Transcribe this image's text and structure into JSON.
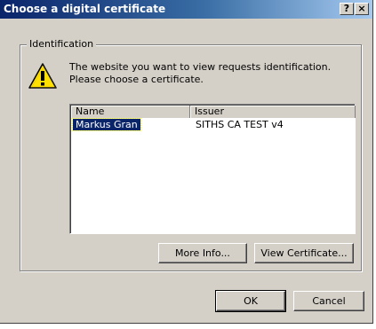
{
  "dialog": {
    "title": "Choose a digital certificate",
    "help_glyph": "?",
    "close_glyph": "×"
  },
  "identification": {
    "legend": "Identification",
    "icon": "warning-icon",
    "message_line1": "The website you want to view requests identification.",
    "message_line2": "Please choose a certificate."
  },
  "certificate_list": {
    "columns": [
      "Name",
      "Issuer"
    ],
    "rows": [
      {
        "name": "Markus Gran",
        "issuer": "SITHS CA TEST v4",
        "selected": true
      }
    ]
  },
  "buttons": {
    "more_info": "More Info...",
    "view_certificate": "View Certificate...",
    "ok": "OK",
    "cancel": "Cancel"
  },
  "colors": {
    "titlebar_start": "#0a246a",
    "titlebar_end": "#a6caf0",
    "face": "#d4d0c8",
    "selection": "#0a246a",
    "warning_yellow": "#ffe000"
  }
}
